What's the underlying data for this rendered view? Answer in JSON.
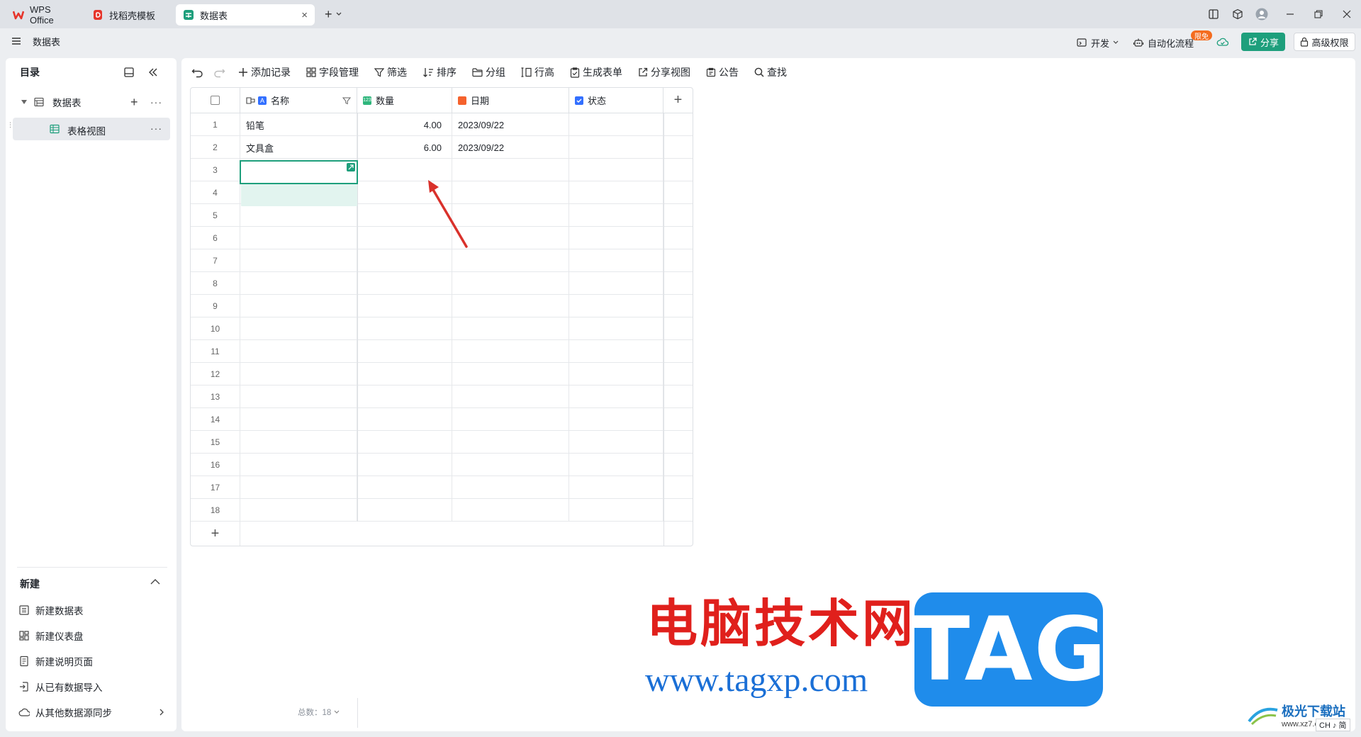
{
  "titlebar": {
    "tabs": [
      {
        "label": "WPS Office"
      },
      {
        "label": "找稻壳模板"
      },
      {
        "label": "数据表"
      }
    ],
    "new_tab": "+"
  },
  "appbar": {
    "doc_title": "数据表",
    "dev_label": "开发",
    "automation_label": "自动化流程",
    "automation_badge": "限免",
    "share_label": "分享",
    "permission_label": "高级权限"
  },
  "sidebar": {
    "title": "目录",
    "tree": [
      {
        "label": "数据表"
      },
      {
        "label": "表格视图"
      }
    ],
    "new_section_title": "新建",
    "new_items": [
      {
        "label": "新建数据表"
      },
      {
        "label": "新建仪表盘"
      },
      {
        "label": "新建说明页面"
      },
      {
        "label": "从已有数据导入"
      },
      {
        "label": "从其他数据源同步"
      }
    ]
  },
  "toolbar": {
    "items": [
      {
        "label": "添加记录"
      },
      {
        "label": "字段管理"
      },
      {
        "label": "筛选"
      },
      {
        "label": "排序"
      },
      {
        "label": "分组"
      },
      {
        "label": "行高"
      },
      {
        "label": "生成表单"
      },
      {
        "label": "分享视图"
      },
      {
        "label": "公告"
      },
      {
        "label": "查找"
      }
    ]
  },
  "grid": {
    "columns": [
      {
        "label": "名称",
        "type": "text",
        "color": "#3370ff"
      },
      {
        "label": "数量",
        "type": "number",
        "color": "#2fb67c"
      },
      {
        "label": "日期",
        "type": "date",
        "color": "#f5622d"
      },
      {
        "label": "状态",
        "type": "checkbox",
        "color": "#3370ff"
      }
    ],
    "rows": [
      {
        "num": "1",
        "name": "铅笔",
        "qty": "4.00",
        "date": "2023/09/22"
      },
      {
        "num": "2",
        "name": "文具盒",
        "qty": "6.00",
        "date": "2023/09/22"
      },
      {
        "num": "3",
        "name": "",
        "qty": "",
        "date": ""
      },
      {
        "num": "4",
        "name": "",
        "qty": "",
        "date": ""
      },
      {
        "num": "5",
        "name": "",
        "qty": "",
        "date": ""
      },
      {
        "num": "6",
        "name": "",
        "qty": "",
        "date": ""
      },
      {
        "num": "7",
        "name": "",
        "qty": "",
        "date": ""
      },
      {
        "num": "8",
        "name": "",
        "qty": "",
        "date": ""
      },
      {
        "num": "9",
        "name": "",
        "qty": "",
        "date": ""
      },
      {
        "num": "10",
        "name": "",
        "qty": "",
        "date": ""
      },
      {
        "num": "11",
        "name": "",
        "qty": "",
        "date": ""
      },
      {
        "num": "12",
        "name": "",
        "qty": "",
        "date": ""
      },
      {
        "num": "13",
        "name": "",
        "qty": "",
        "date": ""
      },
      {
        "num": "14",
        "name": "",
        "qty": "",
        "date": ""
      },
      {
        "num": "15",
        "name": "",
        "qty": "",
        "date": ""
      },
      {
        "num": "16",
        "name": "",
        "qty": "",
        "date": ""
      },
      {
        "num": "17",
        "name": "",
        "qty": "",
        "date": ""
      },
      {
        "num": "18",
        "name": "",
        "qty": "",
        "date": ""
      }
    ],
    "footer_total": "总数：18"
  },
  "watermark": {
    "cn_text": "电脑技术网",
    "url_text": "www.tagxp.com",
    "tag_text": "TAG",
    "corner_text": "极光下载站",
    "corner_url": "www.xz7.com"
  },
  "ime": "CH ♪ 简",
  "colors": {
    "accent": "#1e9f7c",
    "red": "#e03131",
    "blue": "#1f8ceb"
  }
}
